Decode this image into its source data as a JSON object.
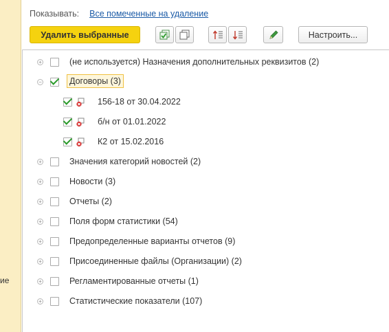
{
  "left_panel": {
    "text_fragment": "ие"
  },
  "header": {
    "show_label": "Показывать:",
    "show_value": "Все помеченные на удаление"
  },
  "toolbar": {
    "delete_selected_label": "Удалить выбранные",
    "settings_label": "Настроить...",
    "icons": [
      "check-all-icon",
      "uncheck-all-icon",
      "sort-asc-icon",
      "sort-desc-icon",
      "edit-icon"
    ]
  },
  "tree": {
    "items": [
      {
        "label": "(не используется) Назначения дополнительных реквизитов (2)",
        "checked": false,
        "expander": "plus"
      },
      {
        "label": "Договоры (3)",
        "checked": true,
        "expander": "minus",
        "selected": true,
        "children": [
          {
            "label": "156-18 от 30.04.2022",
            "checked": true
          },
          {
            "label": "б/н от 01.01.2022",
            "checked": true
          },
          {
            "label": "К2 от 15.02.2016",
            "checked": true
          }
        ]
      },
      {
        "label": "Значения категорий новостей (2)",
        "checked": false,
        "expander": "plus"
      },
      {
        "label": "Новости (3)",
        "checked": false,
        "expander": "plus"
      },
      {
        "label": "Отчеты (2)",
        "checked": false,
        "expander": "plus"
      },
      {
        "label": "Поля форм статистики (54)",
        "checked": false,
        "expander": "plus"
      },
      {
        "label": "Предопределенные варианты отчетов (9)",
        "checked": false,
        "expander": "plus"
      },
      {
        "label": "Присоединенные файлы (Организации) (2)",
        "checked": false,
        "expander": "plus"
      },
      {
        "label": "Регламентированные отчеты (1)",
        "checked": false,
        "expander": "plus"
      },
      {
        "label": "Статистические показатели (107)",
        "checked": false,
        "expander": "plus"
      }
    ]
  }
}
